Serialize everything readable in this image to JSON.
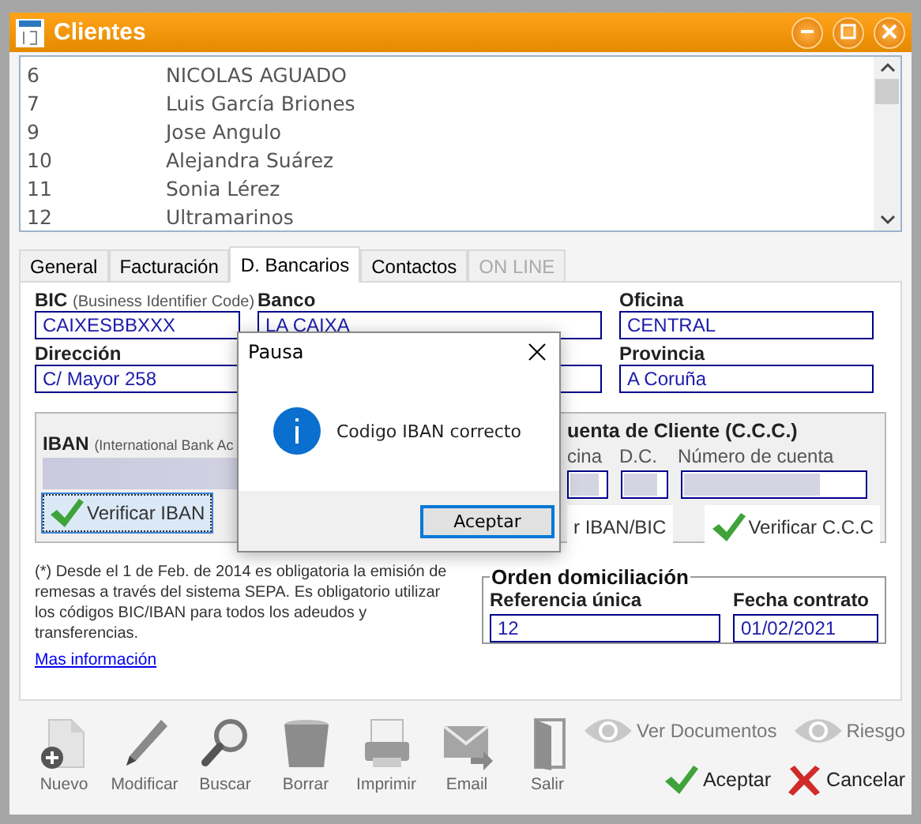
{
  "window": {
    "title": "Clientes"
  },
  "client_list": {
    "rows": [
      {
        "number": "6",
        "name": "NICOLAS AGUADO"
      },
      {
        "number": "7",
        "name": "Luis García Briones"
      },
      {
        "number": "9",
        "name": "Jose Angulo"
      },
      {
        "number": "10",
        "name": "Alejandra Suárez"
      },
      {
        "number": "11",
        "name": "Sonia Lérez"
      },
      {
        "number": "12",
        "name": "Ultramarinos"
      }
    ]
  },
  "tabs": [
    {
      "label": "General",
      "selected": false,
      "disabled": false
    },
    {
      "label": "Facturación",
      "selected": false,
      "disabled": false
    },
    {
      "label": "D. Bancarios",
      "selected": true,
      "disabled": false
    },
    {
      "label": "Contactos",
      "selected": false,
      "disabled": false
    },
    {
      "label": "ON LINE",
      "selected": false,
      "disabled": true
    }
  ],
  "bank_form": {
    "bic": {
      "label": "BIC",
      "hint": "(Business Identifier Code)",
      "value": "CAIXESBBXXX"
    },
    "banco": {
      "label": "Banco",
      "value": "LA CAIXA"
    },
    "oficina": {
      "label": "Oficina",
      "value": "CENTRAL"
    },
    "direccion": {
      "label": "Dirección",
      "value": "C/ Mayor 258"
    },
    "provincia": {
      "label": "Provincia",
      "value": "A Coruña"
    }
  },
  "iban_group": {
    "label": "IBAN",
    "hint": "(International Bank Ac",
    "button": "Verificar IBAN"
  },
  "ccc_group": {
    "title": "uenta de Cliente (C.C.C.)",
    "field_labels": [
      "cina",
      "D.C.",
      "Número de cuenta"
    ],
    "buttons": [
      "r IBAN/BIC",
      "Verificar C.C.C"
    ]
  },
  "note": {
    "text": "(*) Desde el 1 de Feb. de 2014 es obligatoria la emisión de remesas a través del sistema SEPA. Es obligatorio utilizar los códigos BIC/IBAN para todos los adeudos y transferencias.",
    "link": "Mas información"
  },
  "orden": {
    "title": "Orden domiciliación",
    "fields": [
      {
        "label": "Referencia única",
        "value": "12"
      },
      {
        "label": "Fecha contrato",
        "value": "01/02/2021"
      }
    ]
  },
  "toolbar": [
    {
      "label": "Nuevo",
      "kind": "new"
    },
    {
      "label": "Modificar",
      "kind": "edit"
    },
    {
      "label": "Buscar",
      "kind": "search"
    },
    {
      "label": "Borrar",
      "kind": "delete"
    },
    {
      "label": "Imprimir",
      "kind": "print"
    },
    {
      "label": "Email",
      "kind": "email"
    },
    {
      "label": "Salir",
      "kind": "exit"
    }
  ],
  "view_links": [
    {
      "label": "Ver Documentos"
    },
    {
      "label": "Riesgo"
    }
  ],
  "actions": [
    {
      "label": "Aceptar",
      "kind": "ok"
    },
    {
      "label": "Cancelar",
      "kind": "cancel"
    }
  ],
  "dialog": {
    "title": "Pausa",
    "message": "Codigo IBAN correcto",
    "button": "Aceptar"
  }
}
